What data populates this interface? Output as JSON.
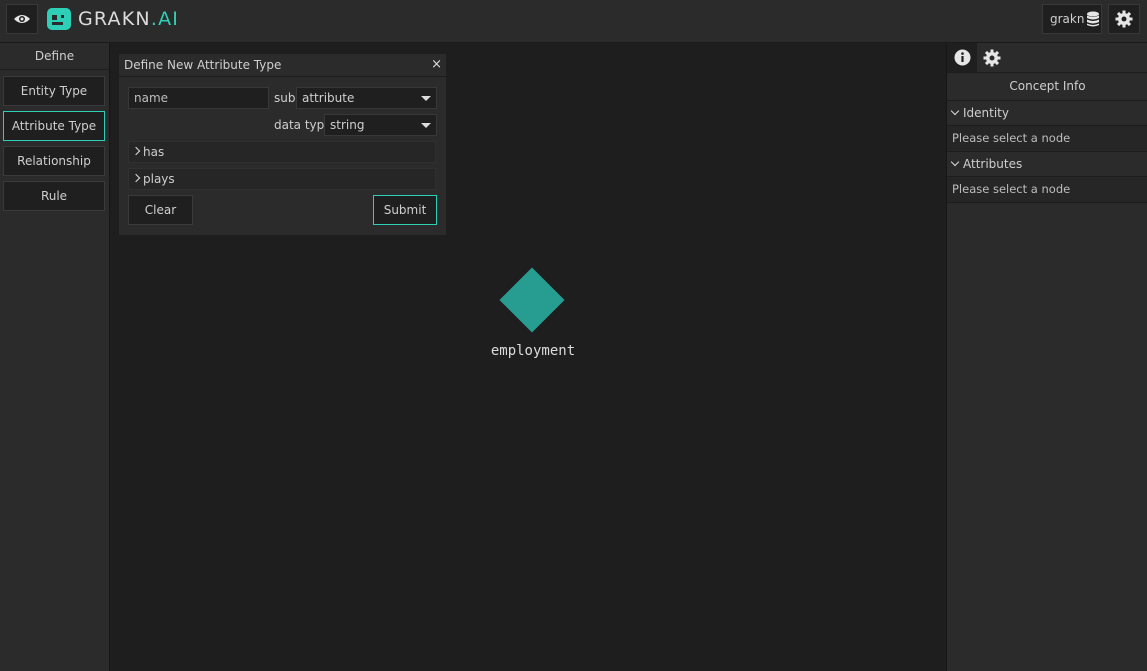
{
  "header": {
    "logo_text": "GRAKN",
    "logo_suffix": ".AI",
    "keyspace": "grakn"
  },
  "left_panel": {
    "title": "Define",
    "buttons": [
      "Entity Type",
      "Attribute Type",
      "Relationship Type",
      "Rule"
    ],
    "active": "Attribute Type"
  },
  "dialog": {
    "title": "Define New Attribute Type",
    "close": "×",
    "name_placeholder": "name",
    "sub_label": "sub",
    "sub_value": "attribute",
    "data_type_label": "data type",
    "data_type_value": "string",
    "has_label": "has",
    "plays_label": "plays",
    "clear_label": "Clear",
    "submit_label": "Submit"
  },
  "graph": {
    "nodes": [
      {
        "label": "employment",
        "shape": "diamond",
        "color": "#279c90"
      }
    ]
  },
  "right_panel": {
    "tabs": [
      "info-icon",
      "gear-icon"
    ],
    "title": "Concept Info",
    "identity_label": "Identity",
    "identity_empty": "Please select a node",
    "attributes_label": "Attributes",
    "attributes_empty": "Please select a node"
  },
  "colors": {
    "accent": "#2dd0b6",
    "node": "#279c90",
    "background": "#1e1e1e",
    "panel": "#2b2b2b"
  }
}
